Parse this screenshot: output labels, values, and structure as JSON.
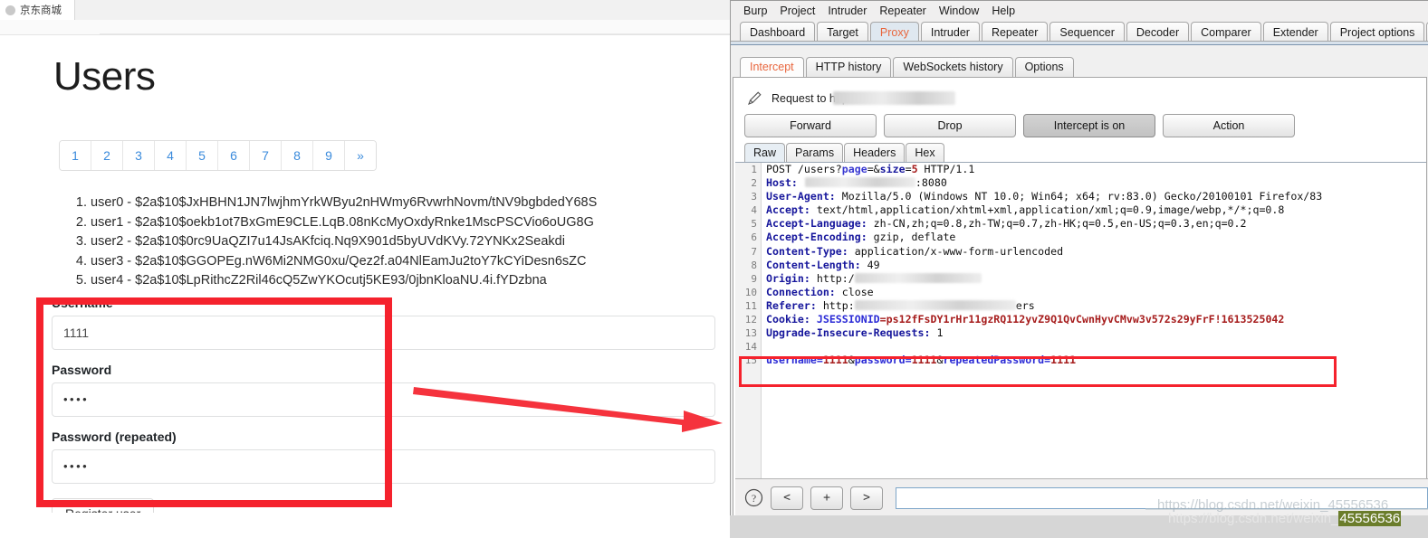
{
  "browser": {
    "tab_title": "京东商城",
    "favicon": "globe-icon"
  },
  "page": {
    "title": "Users",
    "pagination": [
      "1",
      "2",
      "3",
      "4",
      "5",
      "6",
      "7",
      "8",
      "9",
      "»"
    ],
    "users": [
      "user0 - $2a$10$JxHBHN1JN7lwjhmYrkWByu2nHWmy6RvwrhNovm/tNV9bgbdedY68S",
      "user1 - $2a$10$oekb1ot7BxGmE9CLE.LqB.08nKcMyOxdyRnke1MscPSCVio6oUG8G",
      "user2 - $2a$10$0rc9UaQZI7u14JsAKfciq.Nq9X901d5byUVdKVy.72YNKx2Seakdi",
      "user3 - $2a$10$GGOPEg.nW6Mi2NMG0xu/Qez2f.a04NlEamJu2toY7kCYiDesn6sZC",
      "user4 - $2a$10$LpRithcZ2Ril46cQ5ZwYKOcutj5KE93/0jbnKloaNU.4i.fYDzbna"
    ],
    "form": {
      "username_label": "Username",
      "username_value": "1111",
      "password_label": "Password",
      "password_value": "••••",
      "repeated_label": "Password (repeated)",
      "repeated_value": "••••",
      "submit_label": "Register user"
    },
    "annotation": {
      "box_color": "#f5222d",
      "arrow_color": "#f5333d"
    }
  },
  "burp": {
    "menu": [
      "Burp",
      "Project",
      "Intruder",
      "Repeater",
      "Window",
      "Help"
    ],
    "main_tabs": [
      {
        "label": "Dashboard",
        "active": false
      },
      {
        "label": "Target",
        "active": false
      },
      {
        "label": "Proxy",
        "active": true
      },
      {
        "label": "Intruder",
        "active": false
      },
      {
        "label": "Repeater",
        "active": false
      },
      {
        "label": "Sequencer",
        "active": false
      },
      {
        "label": "Decoder",
        "active": false
      },
      {
        "label": "Comparer",
        "active": false
      },
      {
        "label": "Extender",
        "active": false
      },
      {
        "label": "Project options",
        "active": false
      },
      {
        "label": "U",
        "active": false
      }
    ],
    "sub_tabs": [
      {
        "label": "Intercept",
        "active": true
      },
      {
        "label": "HTTP history",
        "active": false
      },
      {
        "label": "WebSockets history",
        "active": false
      },
      {
        "label": "Options",
        "active": false
      }
    ],
    "request_to": "Request to http:/",
    "pencil_icon": "pencil-icon",
    "actions": [
      {
        "label": "Forward",
        "pressed": false
      },
      {
        "label": "Drop",
        "pressed": false
      },
      {
        "label": "Intercept is on",
        "pressed": true
      },
      {
        "label": "Action",
        "pressed": false
      }
    ],
    "raw_tabs": [
      {
        "label": "Raw",
        "active": true
      },
      {
        "label": "Params",
        "active": false
      },
      {
        "label": "Headers",
        "active": false
      },
      {
        "label": "Hex",
        "active": false
      }
    ],
    "request": {
      "line_numbers": [
        "1",
        "2",
        "3",
        "4",
        "5",
        "6",
        "7",
        "8",
        "9",
        "10",
        "11",
        "12",
        "13",
        "14",
        "15"
      ],
      "line1_method": "POST /users?",
      "line1_param1": "page",
      "line1_eq_amp": "=&",
      "line1_param2": "size",
      "line1_eq2": "=",
      "line1_val2": "5",
      "line1_proto": " HTTP/1.1",
      "host_key": "Host:",
      "host_port": ":8080",
      "ua_key": "User-Agent:",
      "ua_value": " Mozilla/5.0 (Windows NT 10.0; Win64; x64; rv:83.0) Gecko/20100101 Firefox/83",
      "accept_key": "Accept:",
      "accept_value": " text/html,application/xhtml+xml,application/xml;q=0.9,image/webp,*/*;q=0.8",
      "lang_key": "Accept-Language:",
      "lang_value": " zh-CN,zh;q=0.8,zh-TW;q=0.7,zh-HK;q=0.5,en-US;q=0.3,en;q=0.2",
      "enc_key": "Accept-Encoding:",
      "enc_value": " gzip, deflate",
      "ctype_key": "Content-Type:",
      "ctype_value": " application/x-www-form-urlencoded",
      "clen_key": "Content-Length:",
      "clen_value": " 49",
      "origin_key": "Origin:",
      "origin_value": " http:/",
      "conn_key": "Connection:",
      "conn_value": " close",
      "referer_key": "Referer:",
      "referer_value": " http:",
      "referer_tail": "ers",
      "cookie_key": "Cookie:",
      "cookie_name": " JSESSIONID",
      "cookie_eq": "=",
      "cookie_value": "ps12fFsDY1rHr11gzRQ112yvZ9Q1QvCwnHyvCMvw3v572s29yFrF!1613525042",
      "upgrade_key": "Upgrade-Insecure-Requests:",
      "upgrade_value": " 1",
      "body_k1": "username",
      "body_v1": "1111",
      "body_amp1": "&",
      "body_k2": "password",
      "body_v2": "1111",
      "body_amp2": "&",
      "body_k3": "repeatedPassword",
      "body_v3": "1111",
      "body_eq": "="
    },
    "bottom": {
      "help_icon": "question-mark-icon",
      "prev_label": "<",
      "add_label": "+",
      "next_label": ">",
      "search_value": ""
    }
  },
  "watermark": {
    "text": "https://blog.csdn.net/weixin_",
    "highlight": "45556536"
  }
}
